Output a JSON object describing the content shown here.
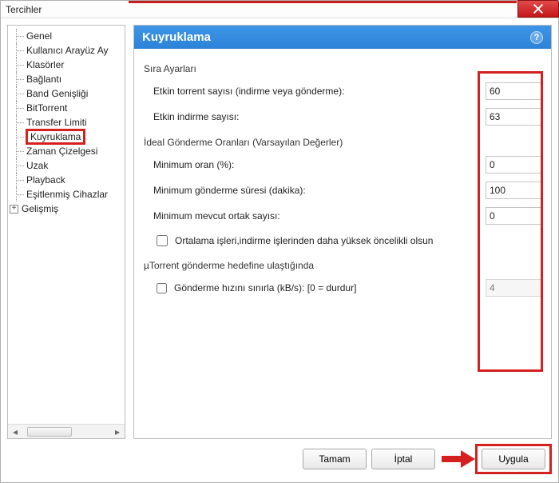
{
  "window": {
    "title": "Tercihler"
  },
  "close_label": "close-icon",
  "tree": {
    "items": [
      {
        "label": "Genel"
      },
      {
        "label": "Kullanıcı Arayüz Ay"
      },
      {
        "label": "Klasörler"
      },
      {
        "label": "Bağlantı"
      },
      {
        "label": "Band Genişliği"
      },
      {
        "label": "BitTorrent"
      },
      {
        "label": "Transfer Limiti"
      },
      {
        "label": "Kuyruklama",
        "selected": true
      },
      {
        "label": "Zaman Çizelgesi"
      },
      {
        "label": "Uzak"
      },
      {
        "label": "Playback"
      },
      {
        "label": "Eşitlenmiş Cihazlar"
      },
      {
        "label": "Gelişmiş",
        "expandable": true
      }
    ]
  },
  "panel": {
    "title": "Kuyruklama",
    "section1": "Sıra Ayarları",
    "row1_label": "Etkin torrent sayısı (indirme veya gönderme):",
    "row1_value": "60",
    "row2_label": "Etkin indirme sayısı:",
    "row2_value": "63",
    "section2": "İdeal Gönderme Oranları (Varsayılan Değerler)",
    "row3_label": "Minimum oran (%):",
    "row3_value": "0",
    "row4_label": "Minimum gönderme süresi (dakika):",
    "row4_value": "100",
    "row5_label": "Minimum mevcut ortak sayısı:",
    "row5_value": "0",
    "check1_label": "Ortalama işleri,indirme işlerinden daha yüksek öncelikli olsun",
    "section3": "µTorrent gönderme hedefine ulaştığında",
    "check2_label": "Gönderme hızını sınırla (kB/s): [0 = durdur]",
    "limit_value": "4"
  },
  "buttons": {
    "ok": "Tamam",
    "cancel": "İptal",
    "apply": "Uygula"
  }
}
